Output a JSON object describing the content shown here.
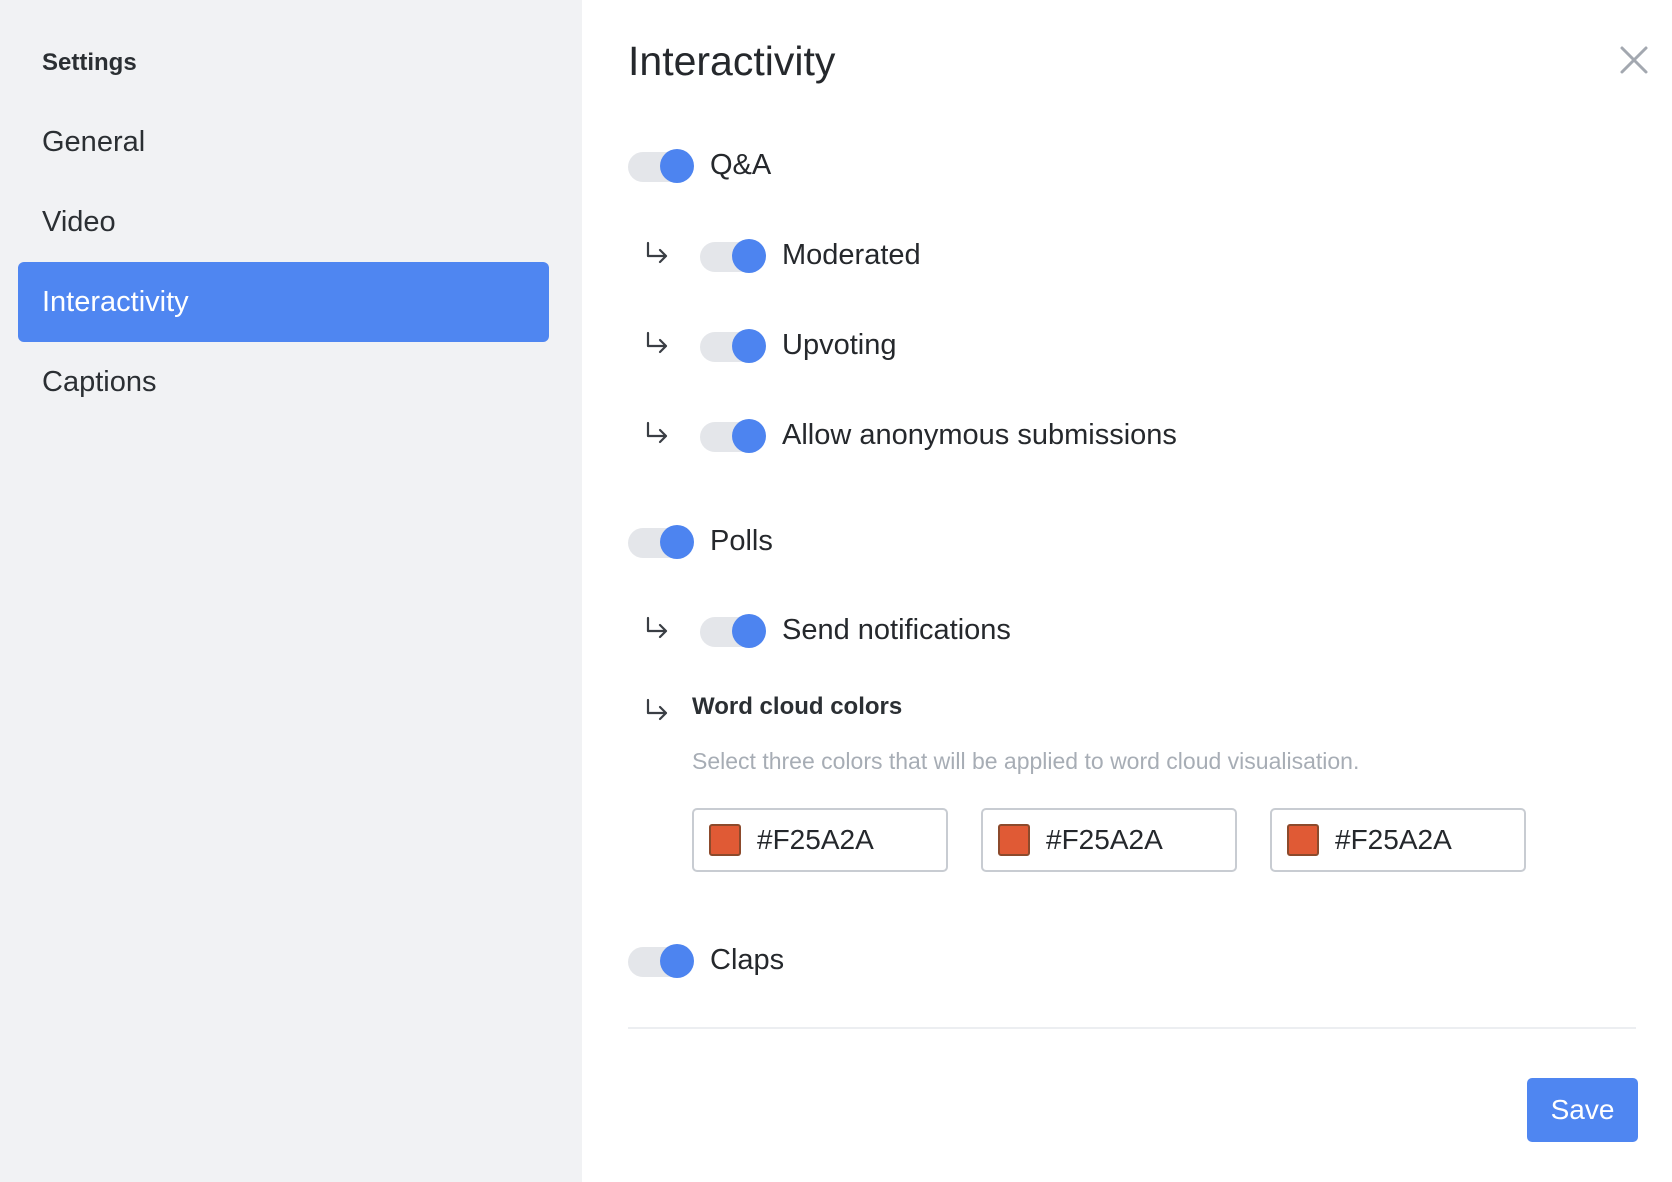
{
  "sidebar": {
    "heading": "Settings",
    "items": [
      {
        "label": "General",
        "active": false
      },
      {
        "label": "Video",
        "active": false
      },
      {
        "label": "Interactivity",
        "active": true
      },
      {
        "label": "Captions",
        "active": false
      }
    ]
  },
  "main": {
    "title": "Interactivity",
    "close_icon": "close-icon",
    "toggles": {
      "qa": {
        "label": "Q&A",
        "on": true
      },
      "moderated": {
        "label": "Moderated",
        "on": true
      },
      "upvoting": {
        "label": "Upvoting",
        "on": true
      },
      "anonymous": {
        "label": "Allow anonymous submissions",
        "on": true
      },
      "polls": {
        "label": "Polls",
        "on": true
      },
      "notifications": {
        "label": "Send notifications",
        "on": true
      },
      "claps": {
        "label": "Claps",
        "on": true
      }
    },
    "word_cloud": {
      "title": "Word cloud colors",
      "description": "Select three colors that will be applied to word cloud visualisation.",
      "colors": [
        {
          "value": "#F25A2A",
          "swatch": "#E05A35"
        },
        {
          "value": "#F25A2A",
          "swatch": "#E05A35"
        },
        {
          "value": "#F25A2A",
          "swatch": "#E05A35"
        }
      ]
    },
    "save_label": "Save"
  },
  "colors": {
    "accent": "#4F86F1",
    "sidebar_bg": "#F1F2F4",
    "toggle_track": "#E4E6EA",
    "muted_text": "#A7ADB5"
  }
}
